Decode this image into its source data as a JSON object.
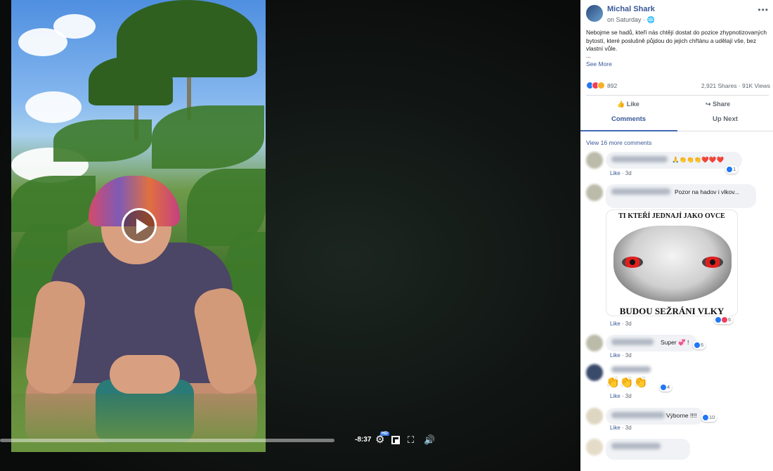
{
  "post": {
    "author": "Michal Shark",
    "time": "on Saturday · ",
    "text": "Nebojme se hadů, kteří nás chtějí dostat do pozice zhypnotizovaných bytostí, které poslušně půjdou do jejich chřtánu a udělají vše, bez vlastní vůle.",
    "ellipsis": "...",
    "see_more": "See More",
    "reaction_count": "892",
    "shares_views": "2,921 Shares · 91K Views",
    "like_label": "Like",
    "share_label": "Share",
    "tabs": [
      "Comments",
      "Up Next"
    ],
    "view_more": "View 16 more comments"
  },
  "video": {
    "time_remaining": "-8:37",
    "hd_badge": "HD",
    "progress_fraction": 0
  },
  "comments": [
    {
      "text": "🙏👏👏👏❤️❤️❤️",
      "meta_like": "Like",
      "meta_time": " · 3d",
      "reactions": "1"
    },
    {
      "text": "Pozor na hadov i vlkov...",
      "meta_like": "Like",
      "meta_time": " · 3d",
      "reactions": "6",
      "image_top": "TI KTEŘÍ JEDNAJÍ JAKO OVCE",
      "image_bottom": "BUDOU SEŽRÁNI VLKY"
    },
    {
      "text": "Super 💞 !",
      "meta_like": "Like",
      "meta_time": " · 3d",
      "reactions": "6"
    },
    {
      "text": "👏👏👏",
      "meta_like": "Like",
      "meta_time": " · 3d",
      "reactions": "4"
    },
    {
      "text": "Výborne !!!!",
      "meta_like": "Like",
      "meta_time": " · 3d",
      "reactions": "10"
    }
  ]
}
